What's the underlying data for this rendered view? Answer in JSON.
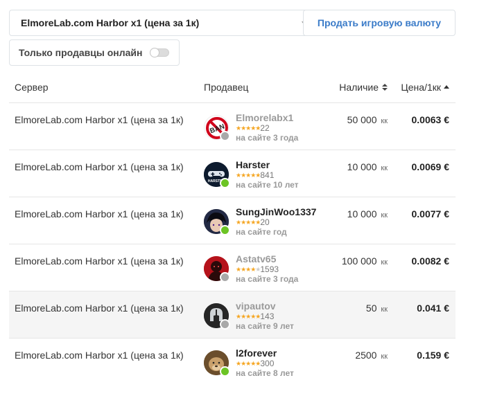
{
  "header": {
    "server_select": "ElmoreLab.com Harbor x1 (цена за 1к)",
    "sell_button": "Продать игровую валюту",
    "online_filter": "Только продавцы онлайн"
  },
  "table": {
    "headers": {
      "server": "Сервер",
      "seller": "Продавец",
      "stock": "Наличие",
      "price": "Цена/1кк"
    },
    "rows": [
      {
        "server": "ElmoreLab.com Harbor x1 (цена за 1к)",
        "seller": "Elmorelabx1",
        "rating": 5,
        "reviews": "22",
        "since": "на сайте 3 года",
        "online": false,
        "stock": "50 000",
        "unit": "кк",
        "price": "0.0063 €"
      },
      {
        "server": "ElmoreLab.com Harbor x1 (цена за 1к)",
        "seller": "Harster",
        "rating": 5,
        "reviews": "841",
        "since": "на сайте 10 лет",
        "online": true,
        "stock": "10 000",
        "unit": "кк",
        "price": "0.0069 €"
      },
      {
        "server": "ElmoreLab.com Harbor x1 (цена за 1к)",
        "seller": "SungJinWoo1337",
        "rating": 5,
        "reviews": "20",
        "since": "на сайте год",
        "online": true,
        "stock": "10 000",
        "unit": "кк",
        "price": "0.0077 €"
      },
      {
        "server": "ElmoreLab.com Harbor x1 (цена за 1к)",
        "seller": "Astatv65",
        "rating": 4,
        "reviews": "1593",
        "since": "на сайте 3 года",
        "online": false,
        "stock": "100 000",
        "unit": "кк",
        "price": "0.0082 €"
      },
      {
        "server": "ElmoreLab.com Harbor x1 (цена за 1к)",
        "seller": "vipautov",
        "rating": 5,
        "reviews": "143",
        "since": "на сайте 9 лет",
        "online": false,
        "stock": "50",
        "unit": "кк",
        "price": "0.041 €"
      },
      {
        "server": "ElmoreLab.com Harbor x1 (цена за 1к)",
        "seller": "l2forever",
        "rating": 5,
        "reviews": "300",
        "since": "на сайте 8 лет",
        "online": true,
        "stock": "2500",
        "unit": "кк",
        "price": "0.159 €"
      }
    ]
  },
  "avatar_text": {
    "ban": "BAN",
    "harster": "HARSTER"
  },
  "colors": {
    "accent": "#3a7bc8",
    "online": "#6cc425",
    "offline": "#a9a9a9",
    "star": "#f5a623"
  },
  "icons": {
    "sort_stock": "sort-both-icon",
    "sort_price": "sort-asc-icon",
    "dropdown": "chevron-down-icon"
  }
}
